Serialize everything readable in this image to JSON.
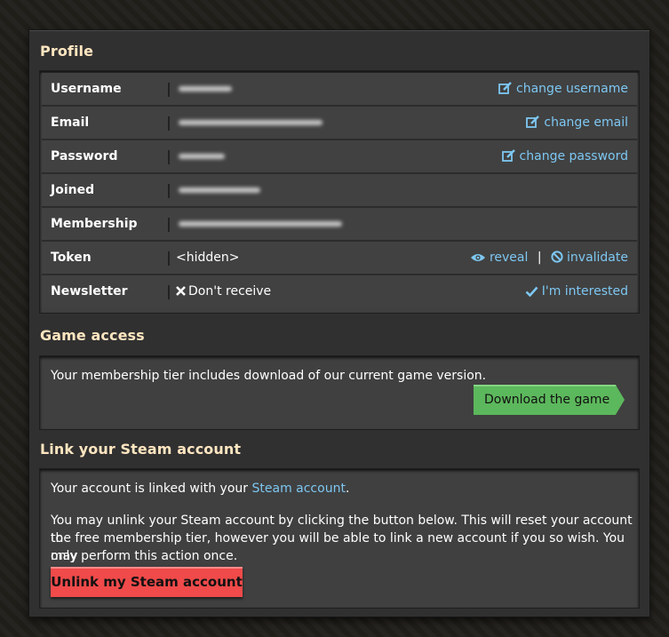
{
  "profile": {
    "title": "Profile",
    "rows": [
      {
        "label": "Username",
        "value": "",
        "action": "change username"
      },
      {
        "label": "Email",
        "value": "",
        "action": "change email"
      },
      {
        "label": "Password",
        "value": "",
        "action": "change password"
      },
      {
        "label": "Joined",
        "value": ""
      },
      {
        "label": "Membership",
        "value": ""
      },
      {
        "label": "Token",
        "value": "<hidden>",
        "action_reveal": "reveal",
        "separator": "|",
        "action_invalidate": "invalidate"
      },
      {
        "label": "Newsletter",
        "value": "Don't receive",
        "action": "I'm interested"
      }
    ]
  },
  "game_access": {
    "title": "Game access",
    "text": "Your membership tier includes download of our current game version.",
    "download_label": "Download the game"
  },
  "steam": {
    "title": "Link your Steam account",
    "linked_prefix": "Your account is linked with your ",
    "linked_link": "Steam account",
    "linked_suffix": ".",
    "unlink_text_1": "You may unlink your Steam account by clicking the button below. This will reset your account to",
    "unlink_text_2": "the free membership tier, however you will be able to link a new account if you so wish. You may",
    "unlink_text_3": "only perform this action once.",
    "unlink_label": "Unlink my Steam account"
  },
  "colors": {
    "accent_link": "#7dc7f2",
    "title": "#ffe6c0",
    "green_button": "#5cb85c",
    "red_button": "#f04a4a"
  }
}
